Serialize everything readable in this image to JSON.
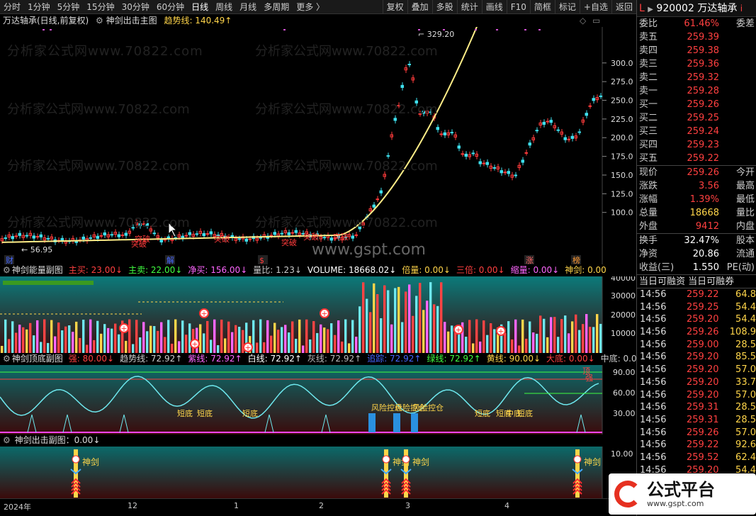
{
  "toolbar": {
    "left": [
      "分时",
      "1分钟",
      "5分钟",
      "15分钟",
      "30分钟",
      "60分钟",
      "日线",
      "周线",
      "月线",
      "多周期",
      "更多 〉"
    ],
    "active_index": 6,
    "right": [
      "复权",
      "叠加",
      "多股",
      "统计",
      "画线",
      "F10",
      "简框",
      "标记",
      "+自选",
      "返回"
    ]
  },
  "title": {
    "stock": "万达轴承(日线,前复权)",
    "indicator": "神剑出击主图",
    "trend_label": "趋势线: 140.49↑"
  },
  "main_chart": {
    "y_ticks": [
      "300.0",
      "275.0",
      "250.0",
      "225.0",
      "200.0",
      "175.0",
      "150.0",
      "125.0",
      "100.0"
    ],
    "high_label": "329.20",
    "low_label": "56.95",
    "badges": [
      "财",
      "解",
      "$",
      "涨",
      "榜"
    ],
    "tags": [
      "突破",
      "突破",
      "突破",
      "突破",
      "突破",
      "突破"
    ]
  },
  "watermark": "分析家公式网www.70822.com",
  "watermark2": "www.gspt.com",
  "panel1": {
    "title": "神剑能量副图",
    "items": [
      {
        "t": "主买: 23.00↓",
        "c": "#ff4040"
      },
      {
        "t": "主卖: 22.00↓",
        "c": "#40ff40"
      },
      {
        "t": "净买: 156.00↓",
        "c": "#ff66ff"
      },
      {
        "t": "量比: 1.23↓",
        "c": "#ccc"
      },
      {
        "t": "VOLUME: 18668.02↓",
        "c": "#fff"
      },
      {
        "t": "倍量: 0.00↓",
        "c": "#ffd54a"
      },
      {
        "t": "三倍: 0.00↓",
        "c": "#ff4040"
      },
      {
        "t": "缩量: 0.00↓",
        "c": "#ff66ff"
      },
      {
        "t": "神剑: 0.00",
        "c": "#ffd54a"
      }
    ],
    "y_ticks": [
      "40000",
      "30000",
      "20000",
      "10000"
    ]
  },
  "panel2": {
    "title": "神剑顶底副图",
    "items": [
      {
        "t": "强: 80.00↓",
        "c": "#ff4040"
      },
      {
        "t": "趋势线: 72.92↑",
        "c": "#ccc"
      },
      {
        "t": "紫线: 72.92↑",
        "c": "#ff66ff"
      },
      {
        "t": "白线: 72.92↑",
        "c": "#fff"
      },
      {
        "t": "灰线: 72.92↑",
        "c": "#bbb"
      },
      {
        "t": "追踪: 72.92↑",
        "c": "#4466ff"
      },
      {
        "t": "绿线: 72.92↑",
        "c": "#40ff40"
      },
      {
        "t": "黄线: 90.00↓",
        "c": "#ffd54a"
      },
      {
        "t": "大底: 0.00↓",
        "c": "#ff4040"
      },
      {
        "t": "中底: 0.00↓",
        "c": "#ccc"
      },
      {
        "t": "短底: 0.00",
        "c": "#ccc"
      }
    ],
    "y_ticks": [
      "90.00",
      "60.00",
      "30.00"
    ],
    "labels": [
      "短底",
      "短底",
      "短底",
      "风险控仓",
      "风险控仓",
      "风险控仓",
      "短底",
      "短底",
      "中底",
      "短底",
      "顶",
      "强"
    ]
  },
  "panel3": {
    "title": "神剑出击副图：0.00↓",
    "y_ticks": [
      "10.00"
    ],
    "signal_label": "神剑"
  },
  "date_axis": [
    "2024年",
    "12",
    "1",
    "2",
    "3",
    "4"
  ],
  "quote": {
    "code": "920002",
    "name": "万达轴承",
    "rows": [
      {
        "k": "委比",
        "v": "61.46%",
        "w": "委差",
        "vc": "red"
      },
      {
        "k": "卖五",
        "v": "259.39",
        "w": "",
        "vc": "red"
      },
      {
        "k": "卖四",
        "v": "259.38",
        "w": "",
        "vc": "red"
      },
      {
        "k": "卖三",
        "v": "259.36",
        "w": "",
        "vc": "red"
      },
      {
        "k": "卖二",
        "v": "259.32",
        "w": "",
        "vc": "red"
      },
      {
        "k": "卖一",
        "v": "259.28",
        "w": "",
        "vc": "red"
      },
      {
        "k": "买一",
        "v": "259.26",
        "w": "",
        "vc": "red"
      },
      {
        "k": "买二",
        "v": "259.25",
        "w": "",
        "vc": "red"
      },
      {
        "k": "买三",
        "v": "259.24",
        "w": "",
        "vc": "red"
      },
      {
        "k": "买四",
        "v": "259.23",
        "w": "",
        "vc": "red"
      },
      {
        "k": "买五",
        "v": "259.22",
        "w": "",
        "vc": "red"
      }
    ],
    "stats": [
      {
        "k": "现价",
        "v": "259.26",
        "w": "今开",
        "vc": "red"
      },
      {
        "k": "涨跌",
        "v": "3.56",
        "w": "最高",
        "vc": "red"
      },
      {
        "k": "涨幅",
        "v": "1.39%",
        "w": "最低",
        "vc": "red"
      },
      {
        "k": "总量",
        "v": "18668",
        "w": "量比",
        "vc": "yellow"
      },
      {
        "k": "外盘",
        "v": "9412",
        "w": "内盘",
        "vc": "red"
      }
    ],
    "stats2": [
      {
        "k": "换手",
        "v": "32.47%",
        "w": "股本",
        "vc": "white"
      },
      {
        "k": "净资",
        "v": "20.86",
        "w": "流通",
        "vc": "white"
      },
      {
        "k": "收益(三)",
        "v": "1.550",
        "w": "PE(动)",
        "vc": "white"
      }
    ],
    "tick_header": [
      "当日可融资",
      "当日可融券"
    ],
    "ticks": [
      [
        "14:56",
        "259.22",
        "64.8"
      ],
      [
        "14:56",
        "259.25",
        "54.4"
      ],
      [
        "14:56",
        "259.20",
        "54.4"
      ],
      [
        "14:56",
        "259.26",
        "108.9"
      ],
      [
        "14:56",
        "259.00",
        "28.5"
      ],
      [
        "14:56",
        "259.20",
        "85.5"
      ],
      [
        "14:56",
        "259.20",
        "57.0"
      ],
      [
        "14:56",
        "259.20",
        "33.7"
      ],
      [
        "14:56",
        "259.20",
        "57.0"
      ],
      [
        "14:56",
        "259.31",
        "28.5"
      ],
      [
        "14:56",
        "259.31",
        "28.5"
      ],
      [
        "14:56",
        "259.26",
        "57.0"
      ],
      [
        "14:56",
        "259.22",
        "92.6"
      ],
      [
        "14:56",
        "259.52",
        "62.4"
      ],
      [
        "14:56",
        "259.20",
        "54.4"
      ]
    ]
  },
  "logo": {
    "text": "公式平台",
    "url": "www.gspt.com"
  }
}
